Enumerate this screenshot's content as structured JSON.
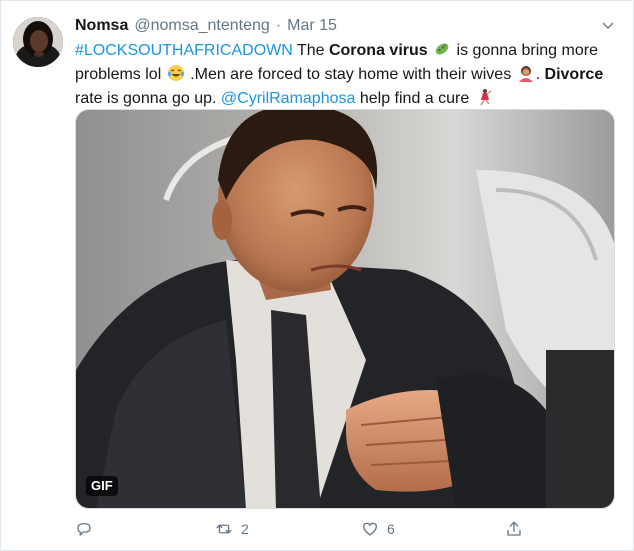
{
  "tweet": {
    "display_name": "Nomsa",
    "handle": "@nomsa_ntenteng",
    "separator": "·",
    "date": "Mar 15",
    "text": {
      "hashtag": "#LOCKSOUTHAFRICADOWN",
      "part1": " The ",
      "bold1": "Corona virus",
      "part2": " is gonna bring more problems lol",
      "part3": " .Men are forced to stay home with their wives",
      "part4": ". ",
      "bold2": "Divorce",
      "part5": " rate is gonna go up. ",
      "mention": "@CyrilRamaphosa",
      "part6": " help find a cure"
    },
    "media": {
      "badge": "GIF"
    },
    "actions": {
      "reply_count": "",
      "retweet_count": "2",
      "like_count": "6"
    }
  },
  "icons": {
    "more": "chevron-down-icon",
    "reply": "reply-icon",
    "retweet": "retweet-icon",
    "like": "heart-icon",
    "share": "share-icon"
  },
  "colors": {
    "link": "#1b95e0",
    "secondary": "#657786",
    "text": "#14171a"
  }
}
